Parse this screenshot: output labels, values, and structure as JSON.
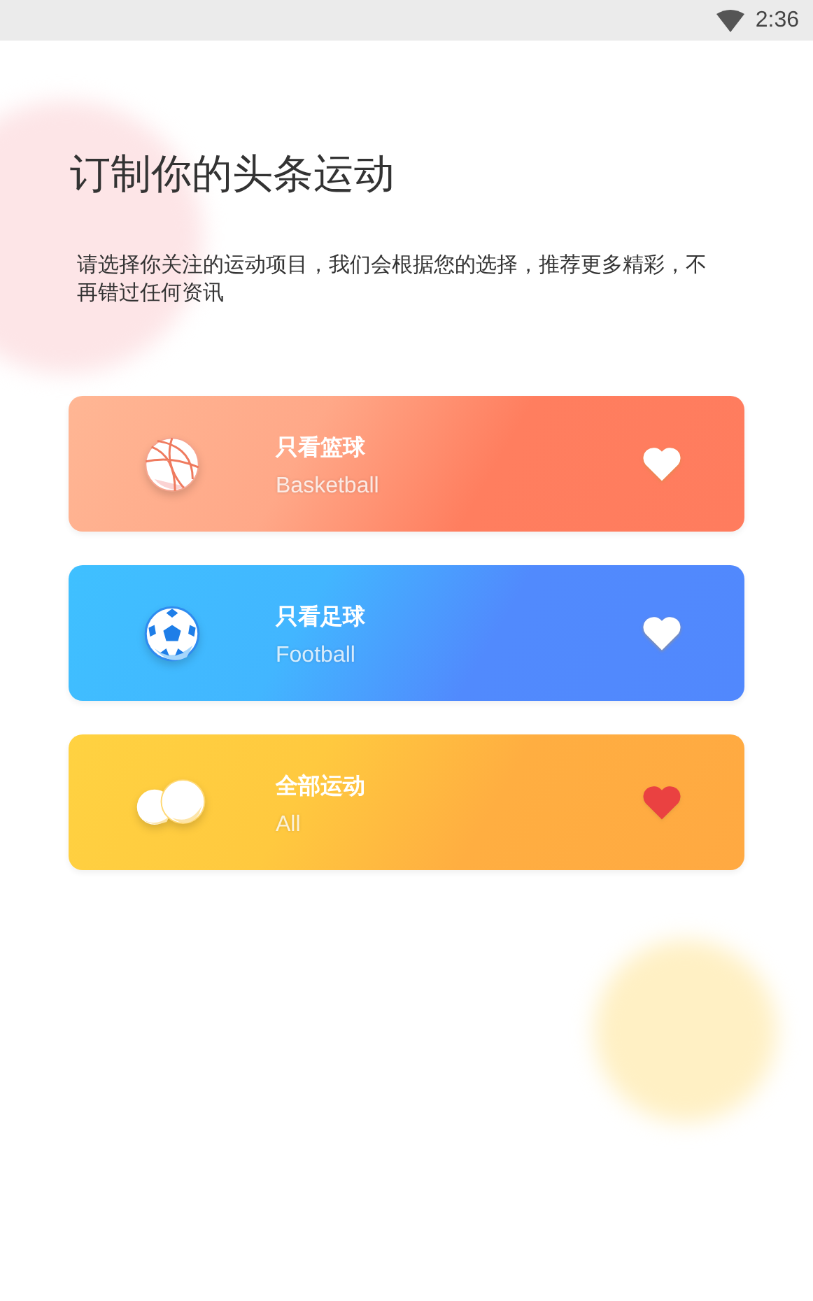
{
  "status_bar": {
    "time": "2:36"
  },
  "title": "订制你的头条运动",
  "subtitle": "请选择你关注的运动项目，我们会根据您的选择，推荐更多精彩，不再错过任何资讯",
  "options": [
    {
      "kind": "basketball",
      "title": "只看篮球",
      "subtitle": "Basketball",
      "selected": false
    },
    {
      "kind": "football",
      "title": "只看足球",
      "subtitle": "Football",
      "selected": false
    },
    {
      "kind": "all",
      "title": "全部运动",
      "subtitle": "All",
      "selected": true
    }
  ]
}
